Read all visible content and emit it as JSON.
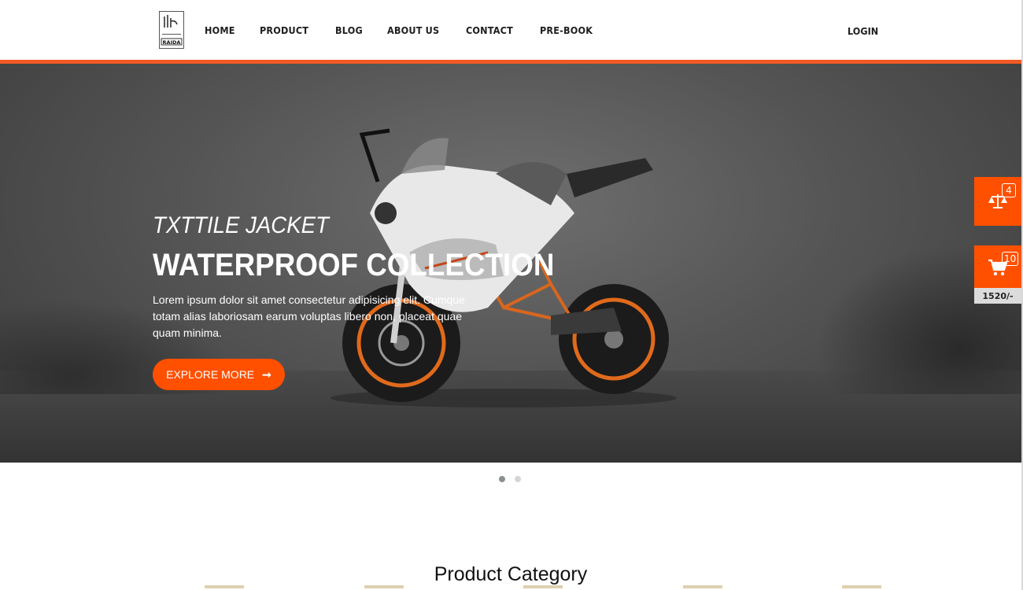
{
  "header": {
    "logo_text": "RAIDA",
    "nav": [
      "HOME",
      "PRODUCT",
      "BLOG",
      "ABOUT US",
      "CONTACT",
      "PRE-BOOK"
    ],
    "login": "LOGIN",
    "accent_color": "#f15a24"
  },
  "hero": {
    "subtitle": "TXTTILE JACKET",
    "title": "WATERPROOF COLLECTION",
    "text": "Lorem ipsum dolor sit amet consectetur adipisicing elit. Cumque totam alias laboriosam earum voluptas libero non, placeat quae quam minima.",
    "button_label": "EXPLORE MORE",
    "button_icon": "arrow-right-icon",
    "button_color": "#ff5000"
  },
  "carousel": {
    "slides": 2,
    "active_slide": 1
  },
  "side": {
    "compare_icon": "scale-icon",
    "compare_count": "4",
    "cart_icon": "cart-icon",
    "cart_count": "10",
    "cart_total": "1520/-"
  },
  "section": {
    "title": "Product Category"
  }
}
